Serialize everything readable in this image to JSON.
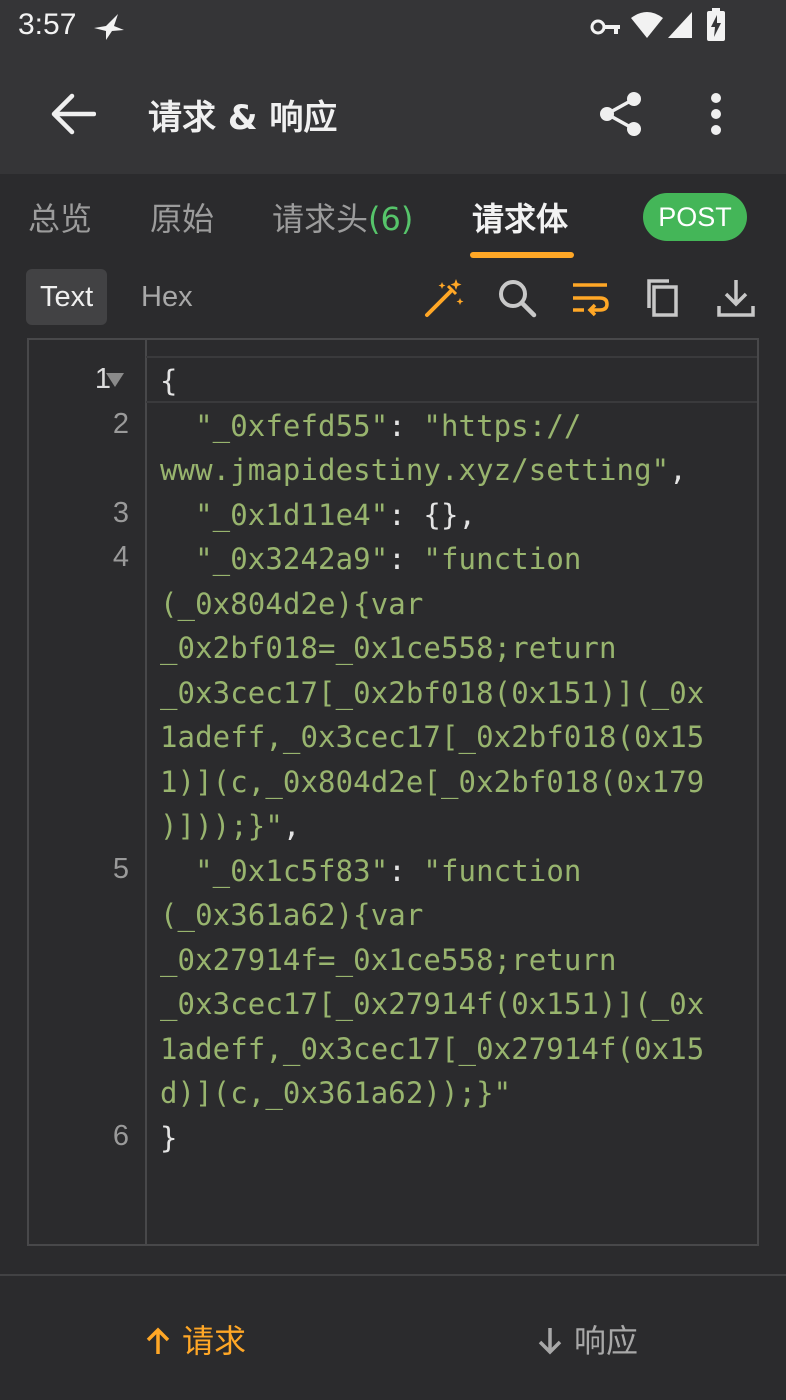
{
  "status_bar": {
    "time": "3:57"
  },
  "app_bar": {
    "title": "请求 & 响应"
  },
  "tabs": [
    {
      "label": "总览"
    },
    {
      "label": "原始"
    },
    {
      "label": "请求头",
      "count": "(6)"
    },
    {
      "label": "请求体",
      "active": true
    }
  ],
  "method_badge": "POST",
  "body_modes": [
    {
      "label": "Text",
      "active": true
    },
    {
      "label": "Hex"
    }
  ],
  "toolbar_icons": [
    "magic-wand-icon",
    "search-icon",
    "wrap-text-icon",
    "copy-icon",
    "download-icon"
  ],
  "editor": {
    "line_numbers": [
      "1",
      "2",
      "3",
      "4",
      "5",
      "6"
    ],
    "lines": {
      "l1": "{",
      "l2a_key": "  \"_0xfefd55\"",
      "l2a_sep": ": ",
      "l2a_val": "\"https://",
      "l2b_val": "www.jmapidestiny.xyz/setting\"",
      "l2b_end": ",",
      "l3_key": "  \"_0x1d11e4\"",
      "l3_rest": ": {},",
      "l4a_key": "  \"_0x3242a9\"",
      "l4a_sep": ": ",
      "l4a_val": "\"function",
      "l4b": "(_0x804d2e){var",
      "l4c": "_0x2bf018=_0x1ce558;return",
      "l4d": "_0x3cec17[_0x2bf018(0x151)](_0x",
      "l4e": "1adeff,_0x3cec17[_0x2bf018(0x15",
      "l4f": "1)](c,_0x804d2e[_0x2bf018(0x179",
      "l4g": ")]));}\"",
      "l4g_end": ",",
      "l5a_key": "  \"_0x1c5f83\"",
      "l5a_sep": ": ",
      "l5a_val": "\"function",
      "l5b": "(_0x361a62){var",
      "l5c": "_0x27914f=_0x1ce558;return",
      "l5d": "_0x3cec17[_0x27914f(0x151)](_0x",
      "l5e": "1adeff,_0x3cec17[_0x27914f(0x15",
      "l5f": "d)](c,_0x361a62));}\"",
      "l6": "}"
    }
  },
  "bottom_nav": {
    "request": "请求",
    "response": "响应"
  },
  "colors": {
    "accent": "#ffa726",
    "badge_green": "#44b658",
    "string_green": "#98b46e",
    "count_green": "#56c46a"
  }
}
